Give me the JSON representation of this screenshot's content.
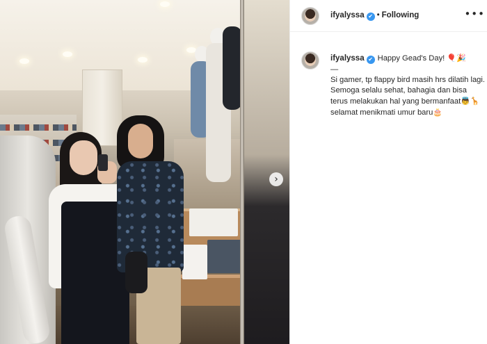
{
  "post": {
    "username": "ifyalyssa",
    "verified_badge": "✔",
    "separator": "•",
    "follow_status": "Following",
    "more_icon": "•••",
    "next_arrow": "›"
  },
  "caption": {
    "username": "ifyalyssa",
    "greeting": "Happy Gead's Day!",
    "greeting_emoji": "🎈🎉",
    "dash": "—",
    "text_before_emoji1": "Si gamer, tp flappy bird masih hrs dilatih lagi. Semoga selalu sehat, bahagia dan bisa terus melakukan hal yang bermanfaat",
    "emoji1": "👼🦒",
    "text_after_emoji1": " selamat menikmati umur baru",
    "emoji2": "🎂"
  }
}
